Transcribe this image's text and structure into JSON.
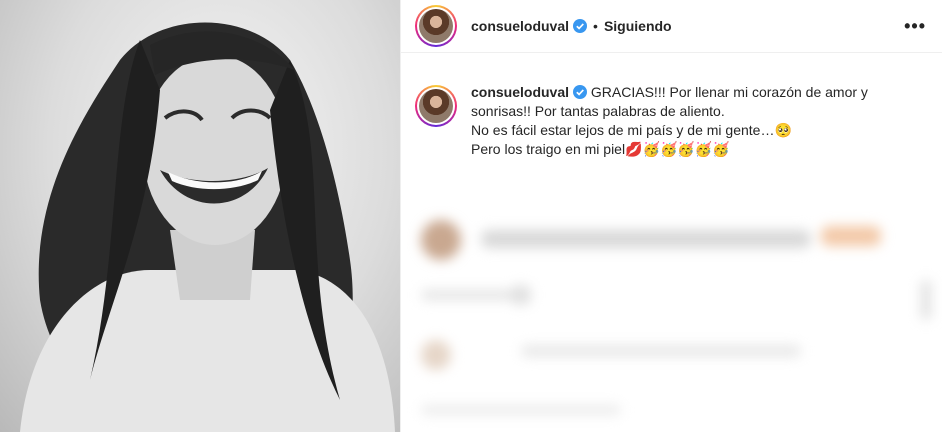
{
  "post": {
    "username": "consueloduval",
    "follow_status": "Siguiendo",
    "dot": "•",
    "more_label": "•••"
  },
  "caption": {
    "username": "consueloduval",
    "lines": [
      "GRACIAS!!! Por llenar mi corazón de amor y",
      "sonrisas!! Por tantas palabras de aliento.",
      "No es fácil estar lejos de mi país y de mi gente…🥺",
      "Pero los traigo en mi piel💋🥳🥳🥳🥳🥳"
    ]
  },
  "colors": {
    "verified": "#3897f0",
    "text": "#262626",
    "border": "#efefef"
  },
  "icons": {
    "verified": "verified-badge-icon",
    "more": "more-options-icon"
  }
}
